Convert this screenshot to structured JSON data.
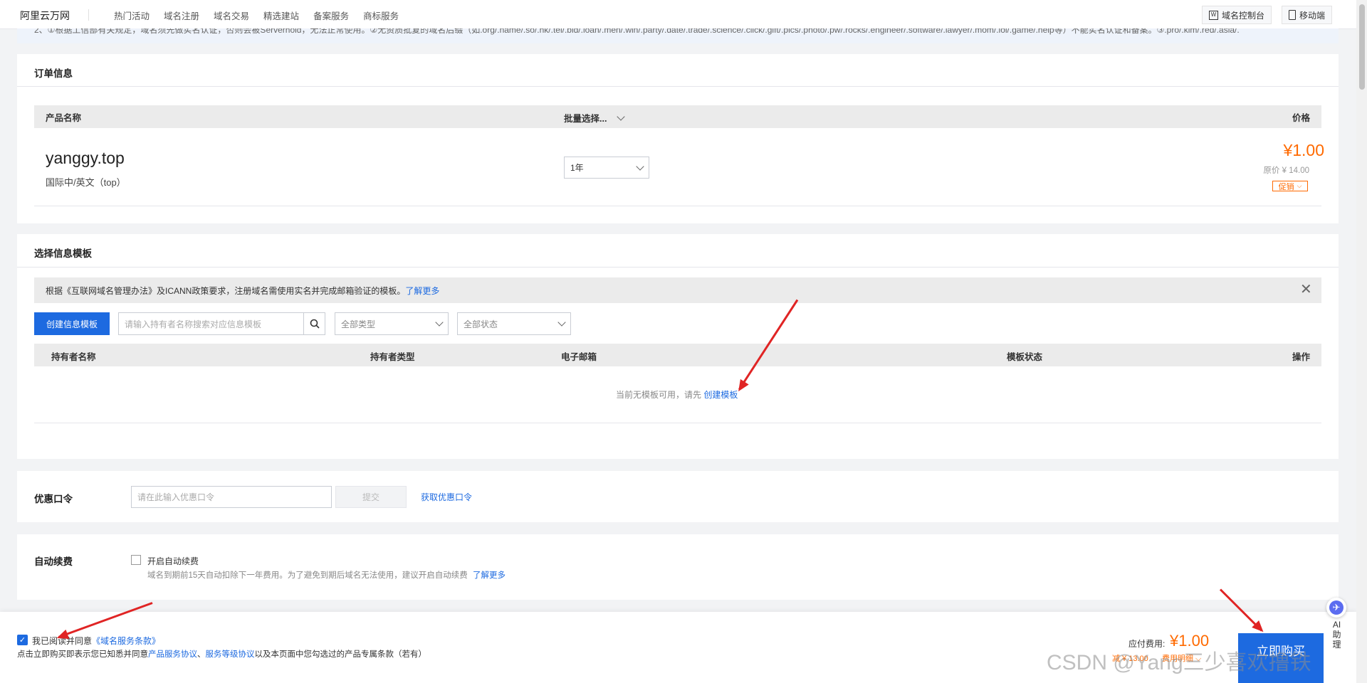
{
  "nav": {
    "logo": "阿里云万网",
    "items": [
      "热门活动",
      "域名注册",
      "域名交易",
      "精选建站",
      "备案服务",
      "商标服务"
    ],
    "console_btn": "域名控制台",
    "mobile_btn": "移动端"
  },
  "notice": "2、①根据工信部有关规定，域名须先做实名认证，否则会被Serverhold，无法正常使用。②无资质批复的域名后缀（如.org/.name/.so/.hk/.tel/.bid/.loan/.men/.win/.party/.date/.trade/.science/.click/.gift/.pics/.photo/.pw/.rocks/.engineer/.software/.lawyer/.mom/.lol/.game/.help等）不能实名认证和备案。③.pro/.kim/.red/.asia/.",
  "order": {
    "title": "订单信息",
    "col_product": "产品名称",
    "col_batch": "批量选择...",
    "col_price": "价格",
    "domain": "yanggy.top",
    "domain_type": "国际中/英文（top）",
    "period": "1年",
    "price": "¥1.00",
    "orig_price": "原价 ¥ 14.00",
    "promo": "促销"
  },
  "template": {
    "title": "选择信息模板",
    "tip": "根据《互联网域名管理办法》及ICANN政策要求，注册域名需使用实名并完成邮箱验证的模板。",
    "tip_link": "了解更多",
    "create_btn": "创建信息模板",
    "search_placeholder": "请输入持有者名称搜索对应信息模板",
    "type_select": "全部类型",
    "status_select": "全部状态",
    "cols": [
      "持有者名称",
      "持有者类型",
      "电子邮箱",
      "模板状态",
      "操作"
    ],
    "empty_text": "当前无模板可用，请先",
    "empty_link": "创建模板"
  },
  "coupon": {
    "label": "优惠口令",
    "placeholder": "请在此输入优惠口令",
    "submit": "提交",
    "get_link": "获取优惠口令"
  },
  "renew": {
    "label": "自动续费",
    "checkbox_label": "开启自动续费",
    "desc": "域名到期前15天自动扣除下一年费用。为了避免到期后域名无法使用，建议开启自动续费",
    "link": "了解更多"
  },
  "footer": {
    "agree_text": "我已阅读并同意",
    "agree_link": "《域名服务条款》",
    "note_pre": "点击立即购买即表示您已知悉并同意",
    "note_link1": "产品服务协议",
    "note_sep": "、",
    "note_link2": "服务等级协议",
    "note_post": "以及本页面中您勾选过的产品专属条款（若有）",
    "pay_label": "应付费用:",
    "pay_amount": "¥1.00",
    "saved": "减 ¥ 13.00",
    "price_detail": "费用明细",
    "buy_btn": "立即购买",
    "ai": [
      "AI",
      "助",
      "理"
    ],
    "watermark": "CSDN @Yang三少喜欢撸铁"
  },
  "colors": {
    "accent": "#1d6ae0",
    "price": "#ff6a00",
    "arrow": "#e02424"
  }
}
